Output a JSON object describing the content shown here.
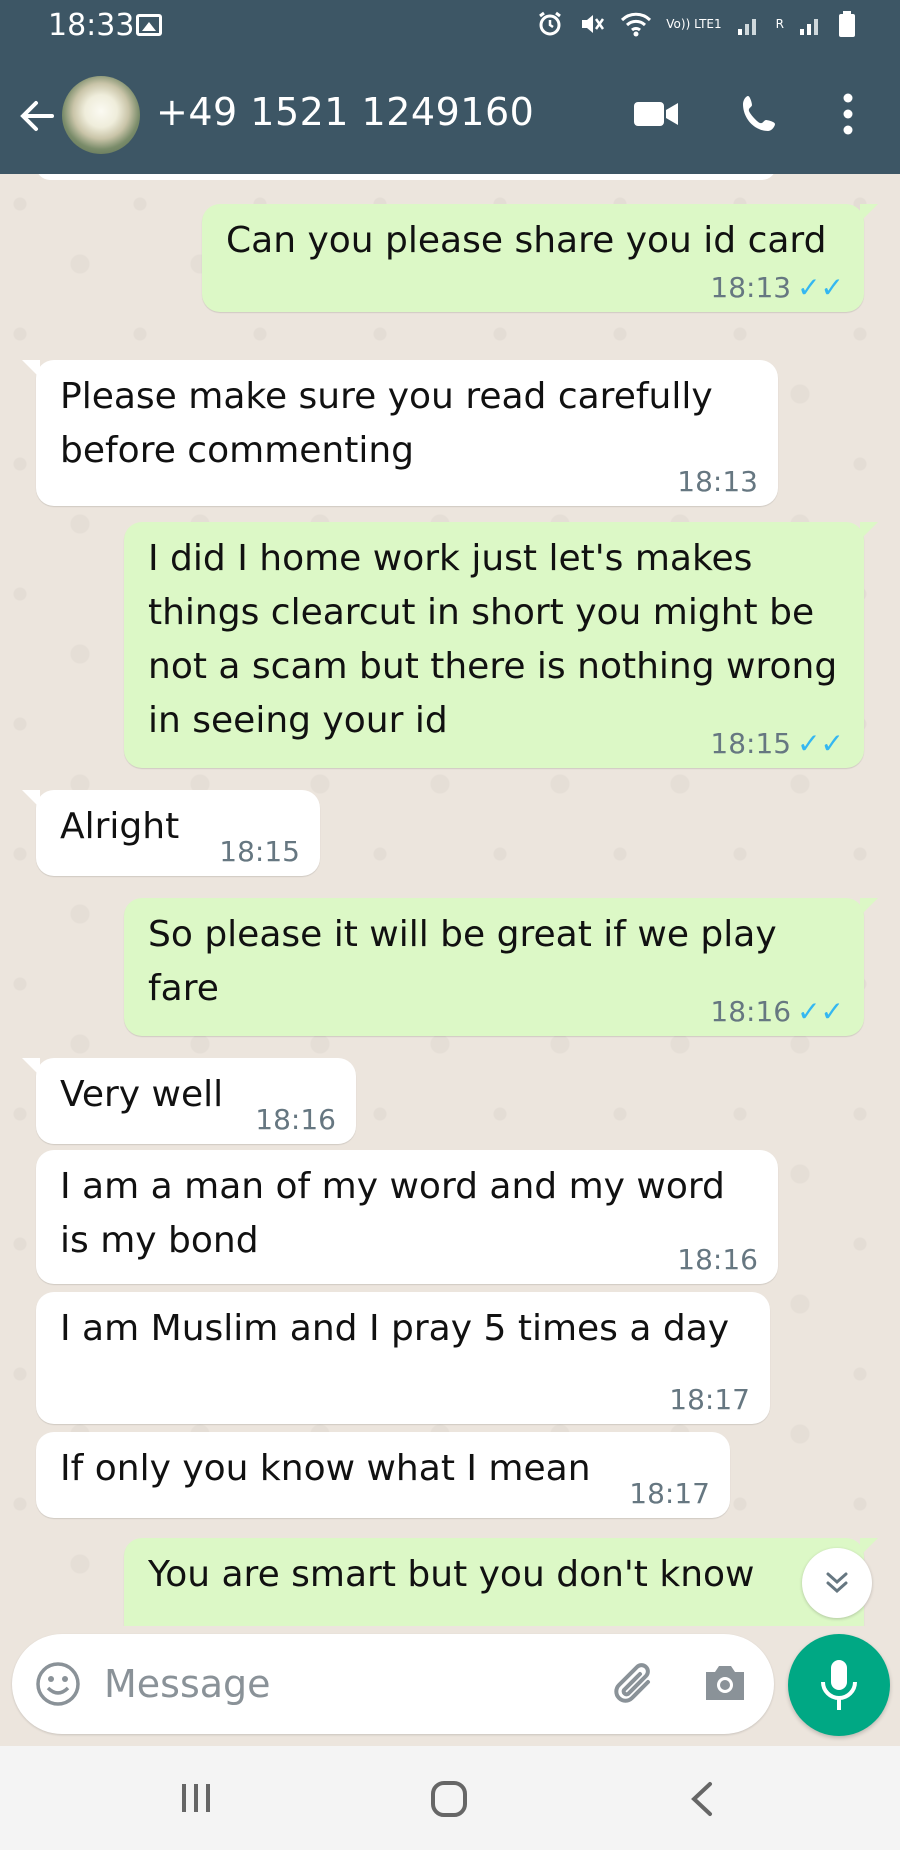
{
  "status_bar": {
    "time": "18:33",
    "network_label": "Vo)) LTE1",
    "roaming_label": "R"
  },
  "header": {
    "contact_name": "+49 1521 1249160"
  },
  "messages": [
    {
      "direction": "out",
      "text": "Can you please share you id card",
      "time": "18:13",
      "ticks": "✓✓"
    },
    {
      "direction": "in",
      "text": "Please make sure you read carefully before commenting",
      "time": "18:13"
    },
    {
      "direction": "out",
      "text": "I did I home work just let's makes things clearcut in short you might be not a scam but there is nothing wrong in seeing your id",
      "time": "18:15",
      "ticks": "✓✓"
    },
    {
      "direction": "in",
      "text": "Alright",
      "time": "18:15"
    },
    {
      "direction": "out",
      "text": "So please it will be great if we play fare",
      "time": "18:16",
      "ticks": "✓✓"
    },
    {
      "direction": "in",
      "text": "Very well",
      "time": "18:16"
    },
    {
      "direction": "in",
      "text": "I am a man of my word and my word is my bond",
      "time": "18:16"
    },
    {
      "direction": "in",
      "text": "I am Muslim and I pray 5 times a day",
      "time": "18:17"
    },
    {
      "direction": "in",
      "text": "If only you know what I mean",
      "time": "18:17"
    },
    {
      "direction": "out",
      "text": "You are smart but you don't know",
      "time": "",
      "ticks": ""
    }
  ],
  "composer": {
    "placeholder": "Message"
  },
  "colors": {
    "header_bg": "#3d5665",
    "chat_bg": "#ece5dd",
    "outgoing_bubble": "#dcf8c6",
    "incoming_bubble": "#ffffff",
    "read_ticks": "#34b7f1",
    "mic_button": "#00a884"
  },
  "icons": [
    "back-arrow-icon",
    "video-call-icon",
    "phone-icon",
    "menu-icon",
    "emoji-icon",
    "attach-icon",
    "camera-icon",
    "mic-icon",
    "scroll-down-icon",
    "nav-recents-icon",
    "nav-home-icon",
    "nav-back-icon"
  ]
}
